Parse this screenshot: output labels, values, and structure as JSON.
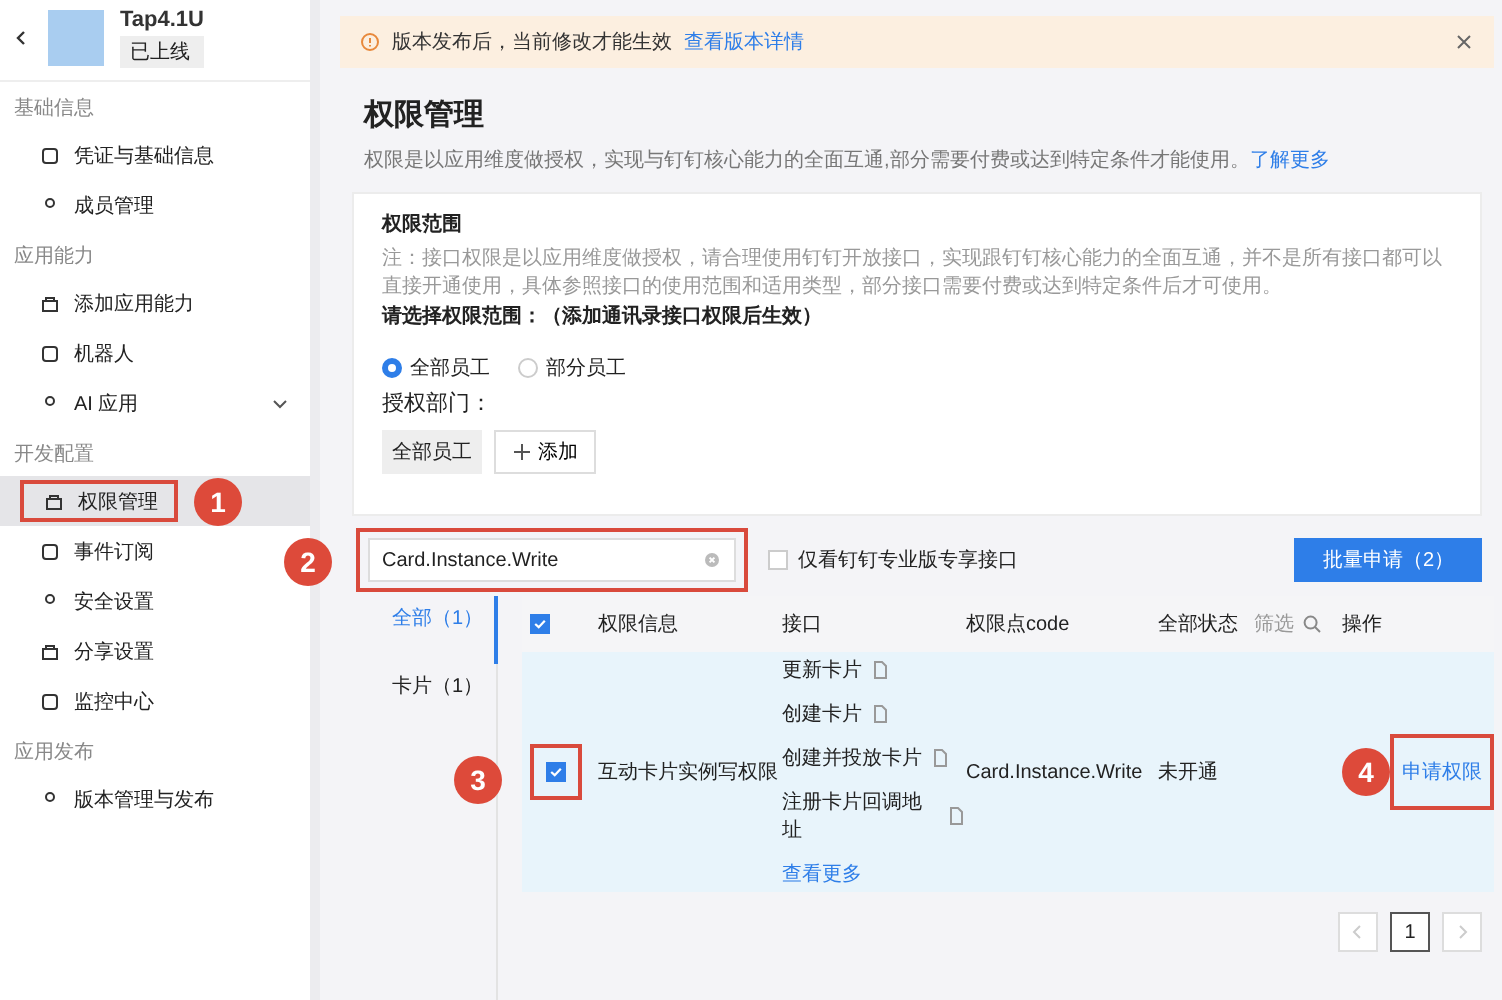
{
  "app": {
    "name": "Tap4.1U",
    "status": "已上线"
  },
  "sidebar": {
    "groups": [
      {
        "title": "基础信息",
        "items": [
          {
            "label": "凭证与基础信息",
            "selected": false
          },
          {
            "label": "成员管理",
            "selected": false
          }
        ]
      },
      {
        "title": "应用能力",
        "items": [
          {
            "label": "添加应用能力",
            "selected": false
          },
          {
            "label": "机器人",
            "selected": false
          },
          {
            "label": "AI 应用",
            "selected": false,
            "expanded": false
          }
        ]
      },
      {
        "title": "开发配置",
        "items": [
          {
            "label": "权限管理",
            "selected": true
          },
          {
            "label": "事件订阅",
            "selected": false
          },
          {
            "label": "安全设置",
            "selected": false
          },
          {
            "label": "分享设置",
            "selected": false
          },
          {
            "label": "监控中心",
            "selected": false
          }
        ]
      },
      {
        "title": "应用发布",
        "items": [
          {
            "label": "版本管理与发布",
            "selected": false
          }
        ]
      }
    ]
  },
  "banner": {
    "text": "版本发布后，当前修改才能生效",
    "link": "查看版本详情"
  },
  "page": {
    "title": "权限管理",
    "description": "权限是以应用维度做授权，实现与钉钉核心能力的全面互通,部分需要付费或达到特定条件才能使用。",
    "link": "了解更多"
  },
  "scope": {
    "title": "权限范围",
    "note": "注：接口权限是以应用维度做授权，请合理使用钉钉开放接口，实现跟钉钉核心能力的全面互通，并不是所有接口都可以直接开通使用，具体参照接口的使用范围和适用类型，部分接口需要付费或达到特定条件后才可使用。",
    "prompt": "请选择权限范围：（添加通讯录接口权限后生效）",
    "options": [
      {
        "label": "全部员工",
        "selected": true
      },
      {
        "label": "部分员工",
        "selected": false
      }
    ],
    "dept_label": "授权部门：",
    "dept_tag": "全部员工",
    "add_button": "添加"
  },
  "toolbar": {
    "search": {
      "value": "Card.Instance.Write"
    },
    "filter": {
      "label": "仅看钉钉专业版专享接口",
      "checked": false
    },
    "batch_button": "批量申请（2）"
  },
  "categories": [
    {
      "label": "全部（1）",
      "selected": true
    },
    {
      "label": "卡片（1）",
      "selected": false
    }
  ],
  "table": {
    "header_checked": true,
    "columns": [
      "权限信息",
      "接口",
      "权限点code",
      "全部状态",
      "操作"
    ],
    "filter_label": "筛选",
    "rows": [
      {
        "checked": true,
        "name": "互动卡片实例写权限",
        "apis": [
          "更新卡片",
          "创建卡片",
          "创建并投放卡片",
          "注册卡片回调地址"
        ],
        "more": "查看更多",
        "code": "Card.Instance.Write",
        "status": "未开通",
        "action": "申请权限"
      }
    ]
  },
  "pagination": {
    "pages": [
      {
        "label": "1",
        "selected": true
      }
    ]
  },
  "annotations": [
    {
      "label": "1"
    },
    {
      "label": "2"
    },
    {
      "label": "3"
    },
    {
      "label": "4"
    }
  ]
}
